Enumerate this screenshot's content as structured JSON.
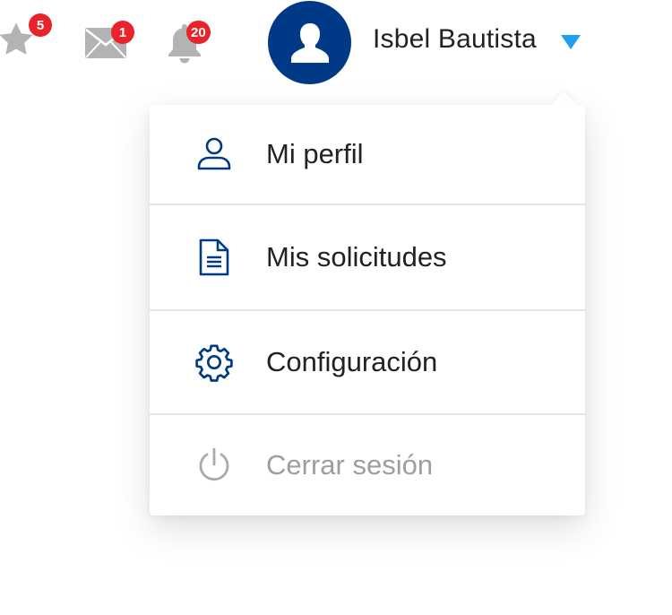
{
  "header": {
    "notifications": [
      {
        "icon": "star-icon",
        "count": "5"
      },
      {
        "icon": "mail-icon",
        "count": "1"
      },
      {
        "icon": "bell-icon",
        "count": "20"
      }
    ],
    "user": {
      "avatar_icon": "user-silhouette-icon",
      "name": "Isbel Bautista",
      "caret_icon": "caret-down-icon"
    },
    "colors": {
      "badge": "#e8232b",
      "avatar": "#003a87",
      "caret": "#1e9ff2",
      "icon_gray": "#b3b3b3",
      "menu_icon": "#003a87"
    }
  },
  "menu": {
    "items": [
      {
        "label": "Mi perfil",
        "icon": "user-icon"
      },
      {
        "label": "Mis solicitudes",
        "icon": "document-icon"
      },
      {
        "label": "Configuración",
        "icon": "gear-icon"
      },
      {
        "label": "Cerrar sesión",
        "icon": "power-icon",
        "muted": true
      }
    ]
  }
}
